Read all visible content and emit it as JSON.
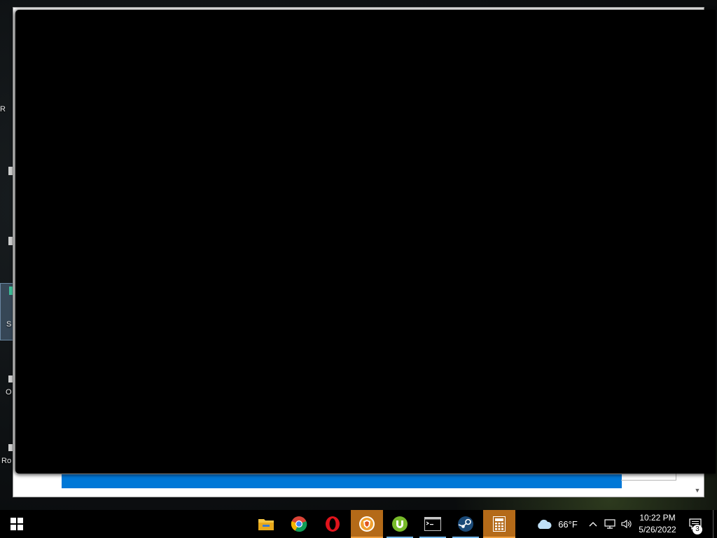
{
  "desktop": {
    "icons": [
      {
        "label": "R"
      },
      {
        "label": ""
      },
      {
        "label": ""
      },
      {
        "label": "S"
      },
      {
        "label": "O"
      },
      {
        "label": "Ro"
      }
    ]
  },
  "taskbar": {
    "apps": [
      {
        "name": "file-explorer",
        "state": "normal"
      },
      {
        "name": "chrome",
        "state": "normal"
      },
      {
        "name": "opera",
        "state": "normal"
      },
      {
        "name": "brave",
        "state": "active"
      },
      {
        "name": "utorrent",
        "state": "running"
      },
      {
        "name": "command-prompt",
        "state": "running"
      },
      {
        "name": "steam",
        "state": "running"
      },
      {
        "name": "calculator",
        "state": "active"
      }
    ],
    "weather": {
      "temperature": "66°F",
      "icon": "cloud-icon"
    },
    "clock": {
      "time": "10:22 PM",
      "date": "5/26/2022"
    },
    "notifications": {
      "count": "3"
    }
  },
  "colors": {
    "accent": "#0078d7",
    "active_task": "#b46a18",
    "running_indicator": "#76b9ed"
  }
}
